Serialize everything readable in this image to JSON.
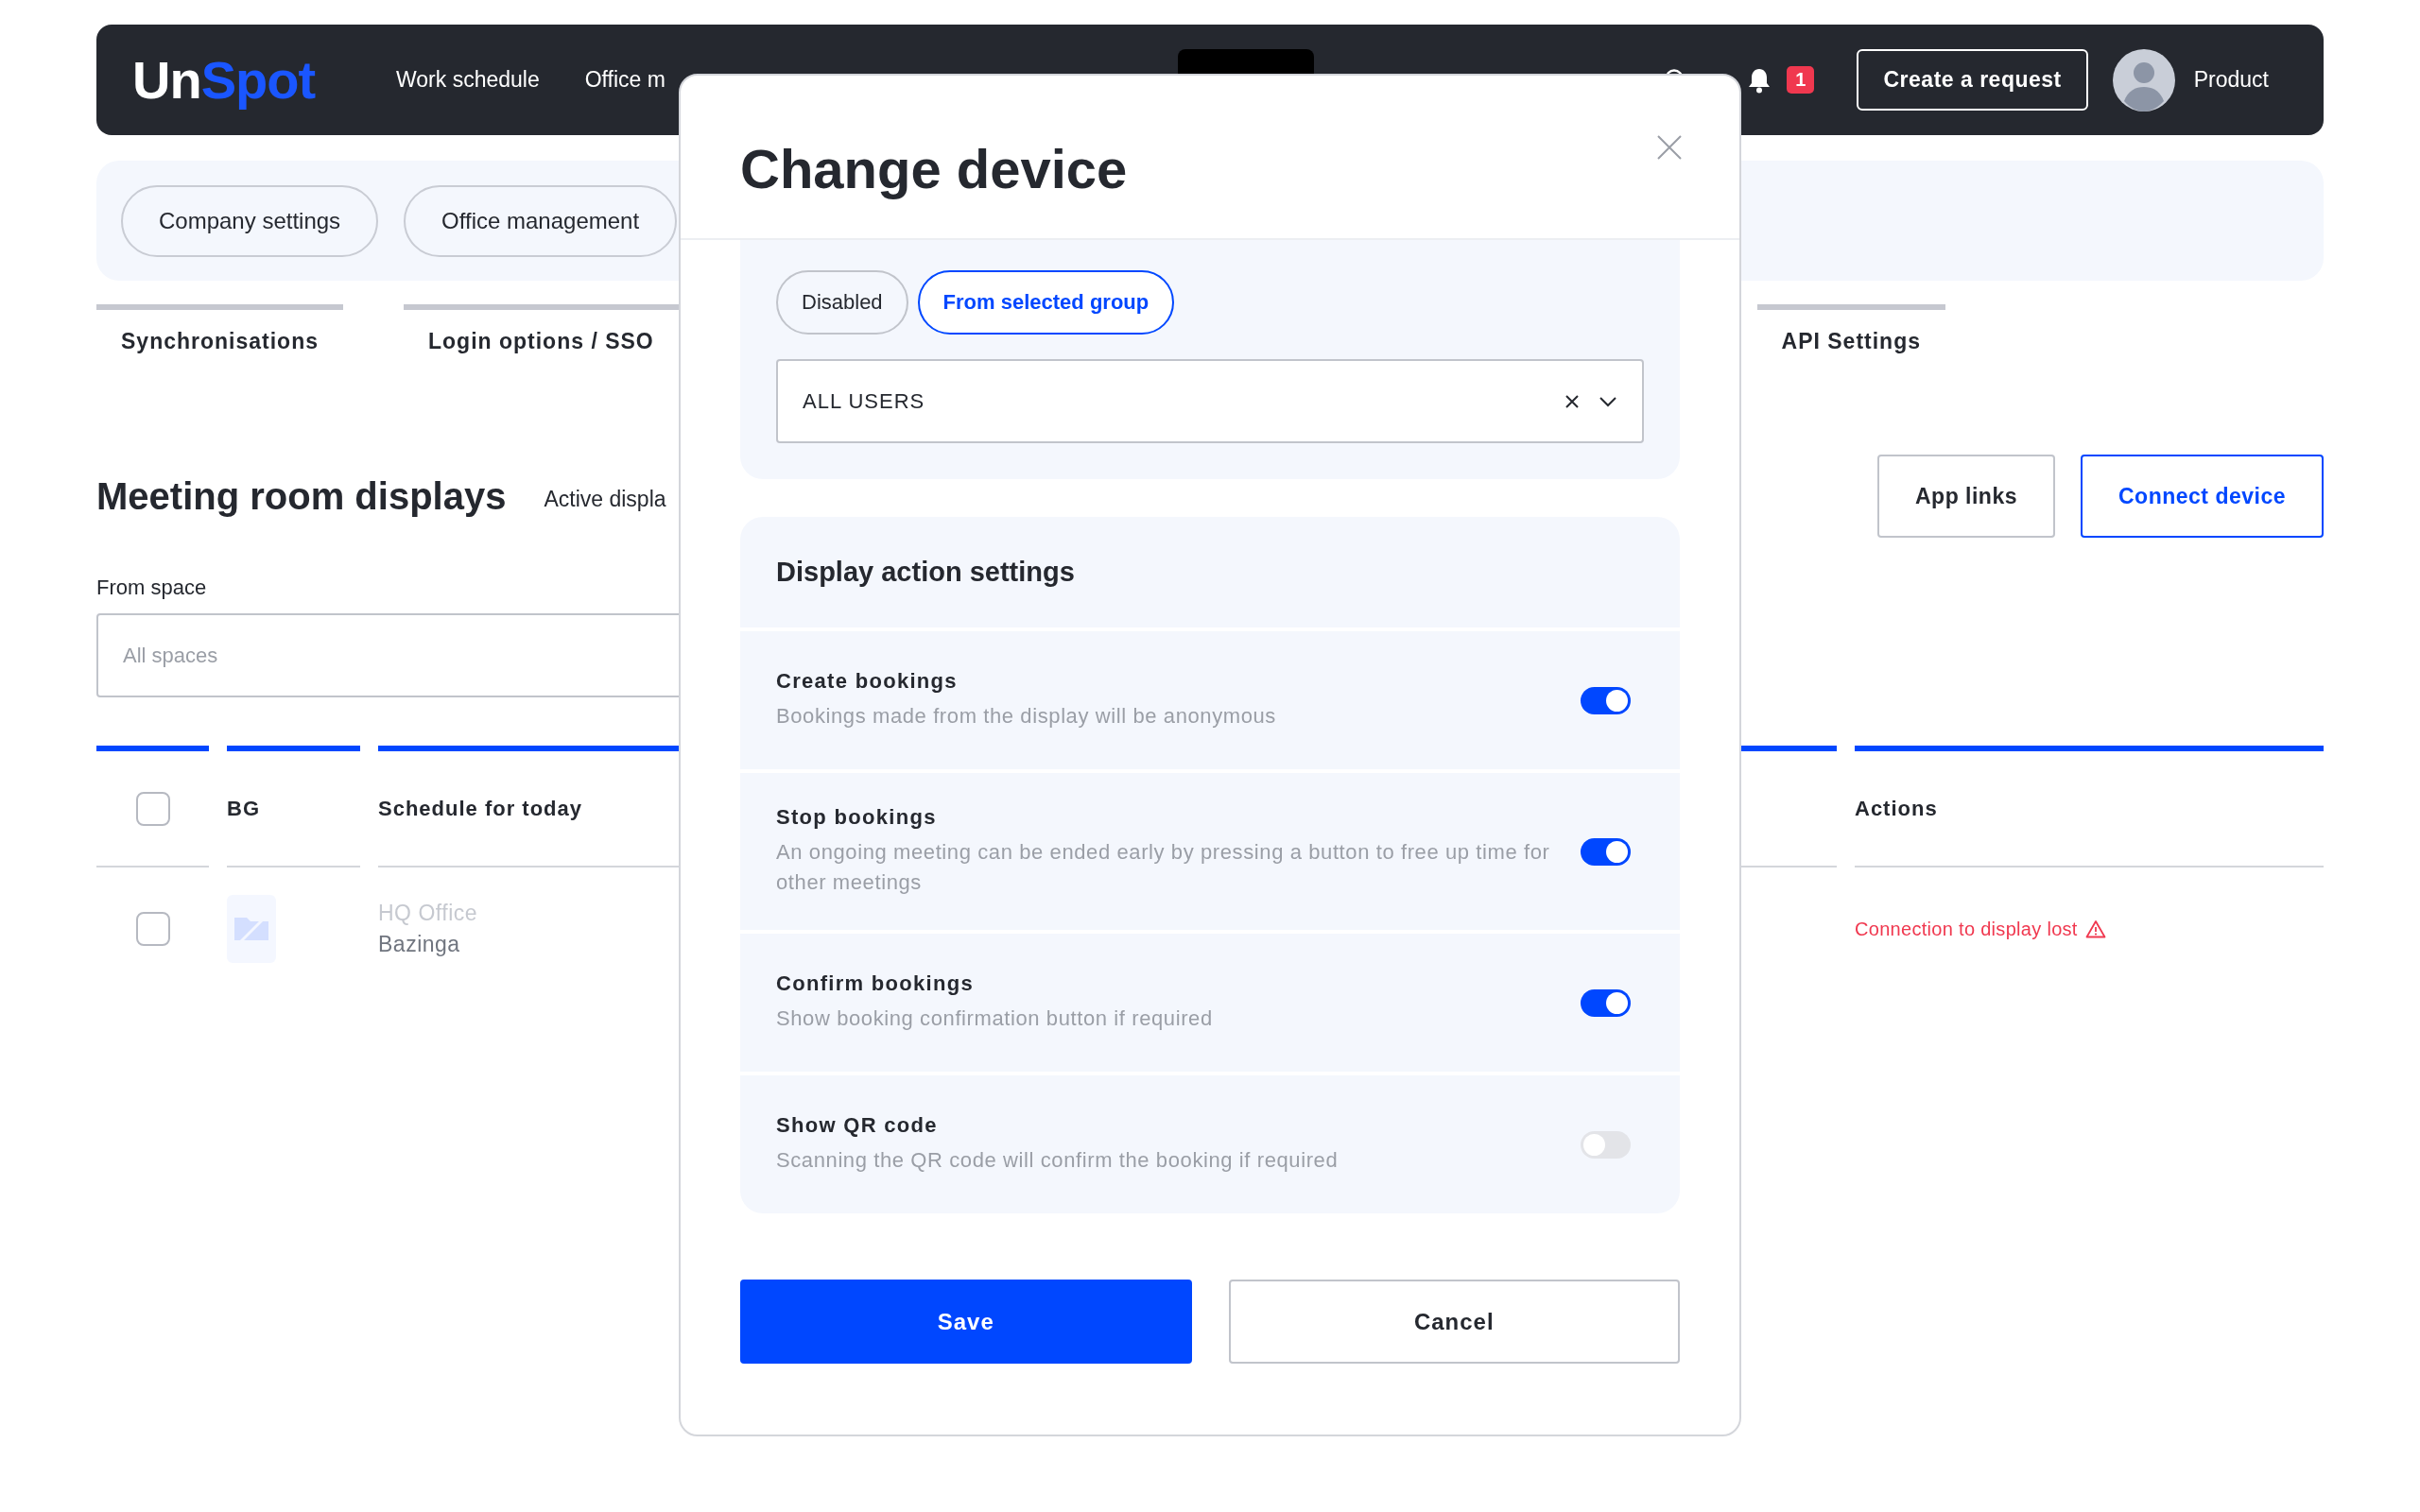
{
  "nav": {
    "logo": [
      {
        "text": "Un",
        "accent": false
      },
      {
        "text": "Spot",
        "accent": true
      }
    ],
    "items": [
      {
        "label": "Work schedule",
        "selected": false
      },
      {
        "label": "Office m",
        "selected": false
      },
      {
        "selected": true
      }
    ],
    "notifications": "1",
    "create_button": "Create a request",
    "user": "Product"
  },
  "settings_sections": [
    {
      "label": "Company settings",
      "selected": false
    },
    {
      "label": "Office management",
      "selected": false
    }
  ],
  "settings_tabs": [
    {
      "label": "Synchronisations",
      "selected": false
    },
    {
      "label": "Login options / SSO",
      "selected": false
    },
    {
      "label": "API Settings",
      "selected": false
    }
  ],
  "page": {
    "title": "Meeting room displays",
    "subtitle": "Active displa",
    "buttons": [
      {
        "label": "App links",
        "kind": "secondary"
      },
      {
        "label": "Connect device",
        "kind": "primary"
      }
    ]
  },
  "filter": {
    "label": "From space",
    "placeholder": "All spaces"
  },
  "table": {
    "header_checked": false,
    "columns": [
      "BG",
      "Schedule for today",
      "Actions"
    ],
    "rows": [
      {
        "checked": false,
        "inactive": true,
        "title": "HQ Office",
        "subtitle": "Bazinga",
        "status": "Connection to display lost"
      }
    ]
  },
  "modal": {
    "title": "Change device",
    "access_options": [
      {
        "label": "Disabled",
        "selected": false
      },
      {
        "label": "From selected group",
        "selected": true
      }
    ],
    "group_select": {
      "value": "ALL USERS"
    },
    "action_settings": {
      "title": "Display action settings",
      "items": [
        {
          "title": "Create bookings",
          "description": "Bookings made from the display will be anonymous",
          "on": true
        },
        {
          "title": "Stop bookings",
          "description": "An ongoing meeting can be ended early by pressing a button to free up time for other meetings",
          "on": true
        },
        {
          "title": "Confirm bookings",
          "description": "Show booking confirmation button if required",
          "on": true
        },
        {
          "title": "Show QR code",
          "description": "Scanning the QR code will confirm the booking if required",
          "on": false
        }
      ]
    },
    "buttons": [
      {
        "label": "Save",
        "kind": "primary"
      },
      {
        "label": "Cancel",
        "kind": "secondary"
      }
    ]
  }
}
